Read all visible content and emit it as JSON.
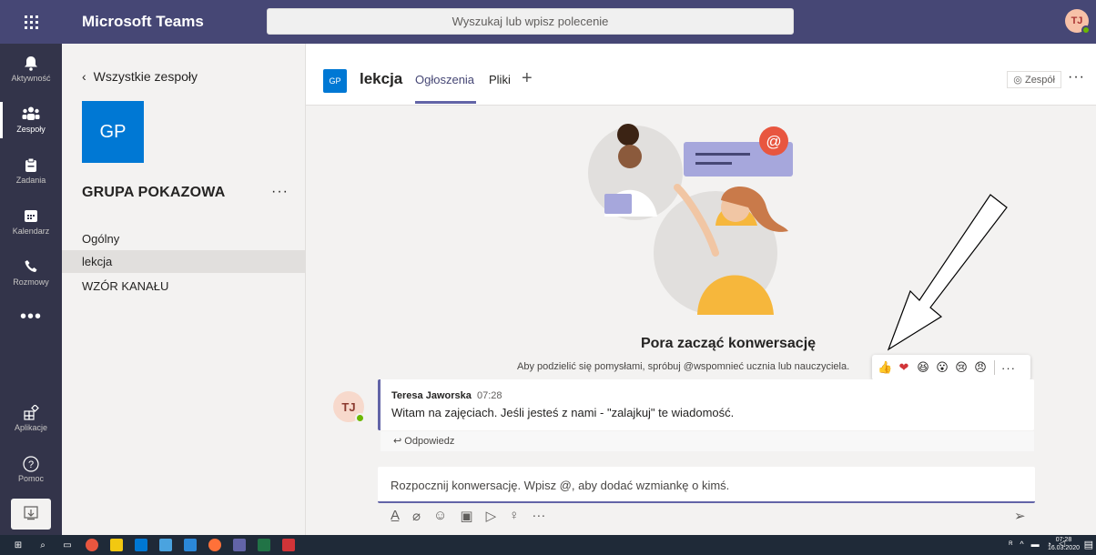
{
  "app": {
    "title": "Microsoft Teams",
    "search_placeholder": "Wyszukaj lub wpisz polecenie",
    "user_initials": "TJ"
  },
  "rail": {
    "items": [
      {
        "label": "Aktywność",
        "icon": "bell-icon"
      },
      {
        "label": "Zespoły",
        "icon": "teams-icon"
      },
      {
        "label": "Zadania",
        "icon": "assignments-icon"
      },
      {
        "label": "Kalendarz",
        "icon": "calendar-icon"
      },
      {
        "label": "Rozmowy",
        "icon": "phone-icon"
      }
    ],
    "more": "•••",
    "bottom": [
      {
        "label": "Aplikacje",
        "icon": "apps-icon"
      },
      {
        "label": "Pomoc",
        "icon": "help-icon"
      }
    ]
  },
  "team_panel": {
    "back_label": "Wszystkie zespoły",
    "team_initials": "GP",
    "team_name": "GRUPA POKAZOWA",
    "more": "···",
    "channels": [
      {
        "name": "Ogólny",
        "selected": false
      },
      {
        "name": "lekcja",
        "selected": true
      },
      {
        "name": "WZÓR KANAŁU",
        "selected": false
      }
    ]
  },
  "channel": {
    "initials": "GP",
    "title": "lekcja",
    "tabs": [
      {
        "label": "Ogłoszenia",
        "active": true
      },
      {
        "label": "Pliki",
        "active": false
      }
    ],
    "add_tab": "+",
    "team_button": "Zespół",
    "more": "···"
  },
  "conversation": {
    "title": "Pora zacząć konwersację",
    "subtitle": "Aby podzielić się pomysłami, spróbuj @wspomnieć ucznia lub nauczyciela."
  },
  "reactions": [
    "👍",
    "❤",
    "😆",
    "😮",
    "😢",
    "😠"
  ],
  "message": {
    "avatar": "TJ",
    "author": "Teresa Jaworska",
    "time": "07:28",
    "text": "Witam na zajęciach. Jeśli jesteś z nami - \"zalajkuj\" te wiadomość.",
    "reply": "Odpowiedz"
  },
  "compose": {
    "placeholder": "Rozpocznij konwersację. Wpisz @, aby dodać wzmiankę o kimś."
  },
  "taskbar": {
    "time": "07:28",
    "date": "16.03.2020"
  },
  "colors": {
    "brand": "#464775",
    "accent": "#6264a7",
    "rail": "#33344a",
    "tile": "#0078d4"
  }
}
